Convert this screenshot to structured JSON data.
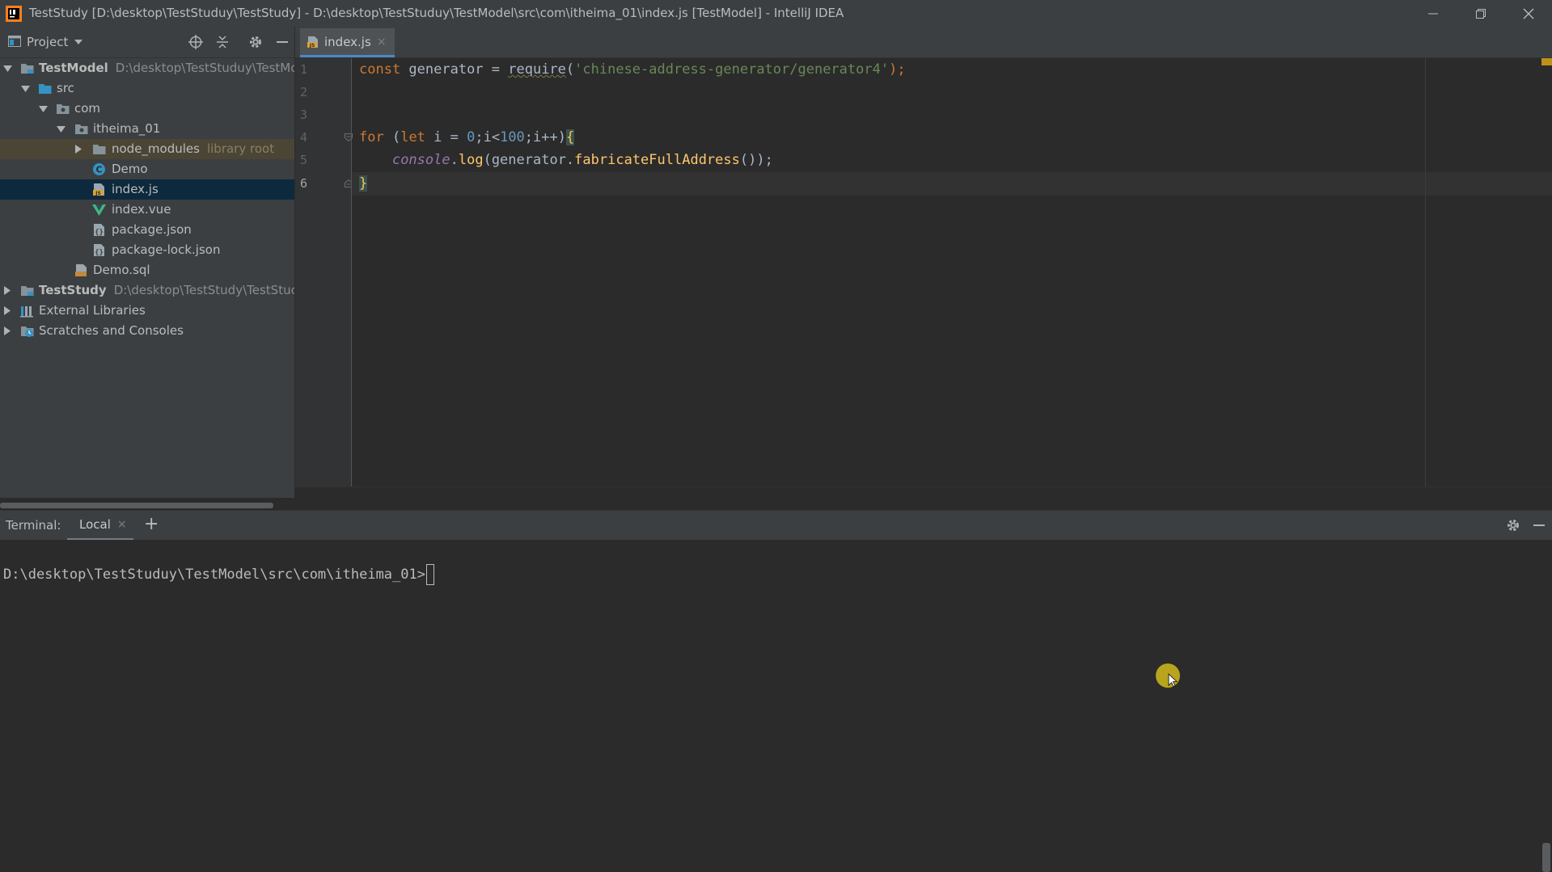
{
  "titlebar": {
    "app_icon": "intellij-icon",
    "title": "TestStudy [D:\\desktop\\TestStuduy\\TestStudy] - D:\\desktop\\TestStuduy\\TestModel\\src\\com\\itheima_01\\index.js [TestModel] - IntelliJ IDEA",
    "buttons": [
      "minimize-icon",
      "restore-icon",
      "close-icon"
    ]
  },
  "project_panel": {
    "title": "Project",
    "toolbar_icons": [
      "locate-icon",
      "collapse-all-icon",
      "gear-icon",
      "hide-icon"
    ],
    "tree": [
      {
        "label": "TestModel",
        "path": "D:\\desktop\\TestStuduy\\TestMo",
        "icon": "module-folder-icon",
        "bold": true
      },
      {
        "label": "src",
        "icon": "source-folder-icon"
      },
      {
        "label": "com",
        "icon": "package-icon"
      },
      {
        "label": "itheima_01",
        "icon": "package-icon"
      },
      {
        "label": "node_modules",
        "hint": "library root",
        "icon": "folder-icon"
      },
      {
        "label": "Demo",
        "icon": "class-icon"
      },
      {
        "label": "index.js",
        "icon": "js-file-icon"
      },
      {
        "label": "index.vue",
        "icon": "vue-file-icon"
      },
      {
        "label": "package.json",
        "icon": "json-file-icon"
      },
      {
        "label": "package-lock.json",
        "icon": "json-file-icon"
      },
      {
        "label": "Demo.sql",
        "icon": "sql-file-icon"
      },
      {
        "label": "TestStudy",
        "path": "D:\\desktop\\TestStudy\\TestStuc",
        "icon": "module-folder-icon",
        "bold": true
      },
      {
        "label": "External Libraries",
        "icon": "libraries-icon"
      },
      {
        "label": "Scratches and Consoles",
        "icon": "scratches-icon"
      }
    ]
  },
  "editor": {
    "tab": {
      "label": "index.js",
      "icon": "js-file-icon",
      "close": "×"
    },
    "line_numbers": [
      "1",
      "2",
      "3",
      "4",
      "5",
      "6"
    ],
    "code": {
      "l1_const": "const",
      "l1_var": " generator = ",
      "l1_require": "require",
      "l1_open": "(",
      "l1_str": "'chinese-address-generator/generator4'",
      "l1_close": ");",
      "l4_for": "for",
      "l4_a": " (",
      "l4_let": "let",
      "l4_b": " i = ",
      "l4_zero": "0",
      "l4_c": ";i<",
      "l4_hundred": "100",
      "l4_d": ";i++)",
      "l4_brace": "{",
      "l5_indent": "    ",
      "l5_console": "console",
      "l5_dot": ".",
      "l5_log": "log",
      "l5_a": "(generator.",
      "l5_fn": "fabricateFullAddress",
      "l5_b": "());",
      "l6_brace": "}"
    }
  },
  "terminal": {
    "label": "Terminal:",
    "tab": "Local",
    "tab_close": "×",
    "add": "+",
    "prompt": "D:\\desktop\\TestStuduy\\TestModel\\src\\com\\itheima_01>",
    "header_icons": [
      "gear-icon",
      "hide-icon"
    ]
  }
}
